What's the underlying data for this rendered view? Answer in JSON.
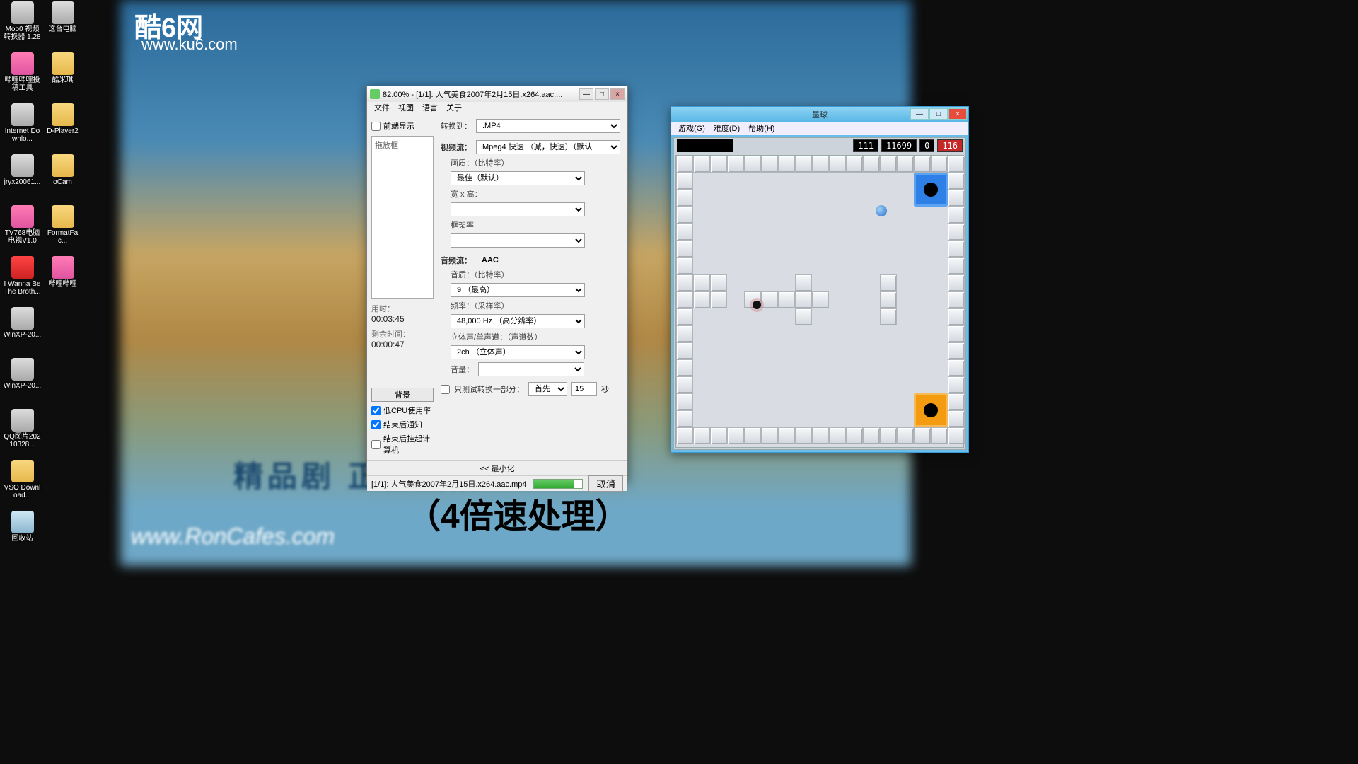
{
  "background": {
    "site_logo": "酷6网",
    "site_url": "www.ku6.com",
    "banner_text": "精品剧  正在热播",
    "footer_url": "www.RonCafes.com",
    "overlay_caption": "（4倍速处理）"
  },
  "desktop_icons": [
    {
      "label": "Moo0 视频转换器 1.28",
      "ic": "ic-app"
    },
    {
      "label": "这台电脑",
      "ic": "ic-app"
    },
    {
      "label": "哔哩哔哩投稿工具",
      "ic": "ic-pink"
    },
    {
      "label": "酷米琪",
      "ic": "ic-folder"
    },
    {
      "label": "Internet Downlo...",
      "ic": "ic-app"
    },
    {
      "label": "D-Player2",
      "ic": "ic-folder"
    },
    {
      "label": "jryx20061...",
      "ic": "ic-app"
    },
    {
      "label": "oCam",
      "ic": "ic-folder"
    },
    {
      "label": "TV768电脑电视V1.0",
      "ic": "ic-pink"
    },
    {
      "label": "FormatFac...",
      "ic": "ic-folder"
    },
    {
      "label": "I Wanna Be The Broth...",
      "ic": "ic-red"
    },
    {
      "label": "哔哩哔哩",
      "ic": "ic-pink"
    },
    {
      "label": "WinXP-20...",
      "ic": "ic-app"
    },
    {
      "label": "",
      "ic": ""
    },
    {
      "label": "WinXP-20...",
      "ic": "ic-app"
    },
    {
      "label": "",
      "ic": ""
    },
    {
      "label": "QQ图片20210328...",
      "ic": "ic-app"
    },
    {
      "label": "",
      "ic": ""
    },
    {
      "label": "VSO Download...",
      "ic": "ic-folder"
    },
    {
      "label": "",
      "ic": ""
    },
    {
      "label": "回收站",
      "ic": "ic-bin"
    }
  ],
  "converter": {
    "title": "82.00% - [1/1]: 人气美食2007年2月15日.x264.aac....",
    "menu": [
      "文件",
      "视图",
      "语言",
      "关于"
    ],
    "front_display": "前端显示",
    "dropbox_label": "拖放框",
    "time_used_label": "用时：",
    "time_used": "00:03:45",
    "time_remain_label": "剩余时间：",
    "time_remain": "00:00:47",
    "bg_button": "背景",
    "chk_lowcpu": "低CPU使用率",
    "chk_finish_notify": "结束后通知",
    "chk_shutdown": "结束后挂起计算机",
    "convert_to_label": "转换到：",
    "convert_to": ".MP4",
    "video_stream_label": "视频流：",
    "video_stream": "Mpeg4  快速    （减，快速）（默认",
    "quality_label": "画质：（比特率）",
    "quality": "最佳（默认）",
    "wh_label": "宽 x 高：",
    "wh": "",
    "frate_label": "框架率",
    "frate": "",
    "audio_stream_label": "音频流：",
    "audio_stream_value": "AAC",
    "aquality_label": "音质：（比特率）",
    "aquality": "9 （最高）",
    "freq_label": "频率：（采样率）",
    "freq": "48,000 Hz （高分辨率）",
    "channel_label": "立体声/单声道：（声道数）",
    "channel": "2ch （立体声）",
    "volume_label": "音量：",
    "volume": "",
    "partial_label": "只测试转换一部分：",
    "partial_mode": "首先",
    "partial_secs": "15",
    "secs_suffix": "秒",
    "minimize": "<< 最小化",
    "status_file": "[1/1]: 人气美食2007年2月15日.x264.aac.mp4  82.00%",
    "cancel": "取消"
  },
  "game": {
    "title": "墨球",
    "menu": [
      "游戏(G)",
      "难度(D)",
      "帮助(H)"
    ],
    "counter1": "111",
    "counter2": "11699",
    "counter3": "0",
    "counter4": "116"
  }
}
